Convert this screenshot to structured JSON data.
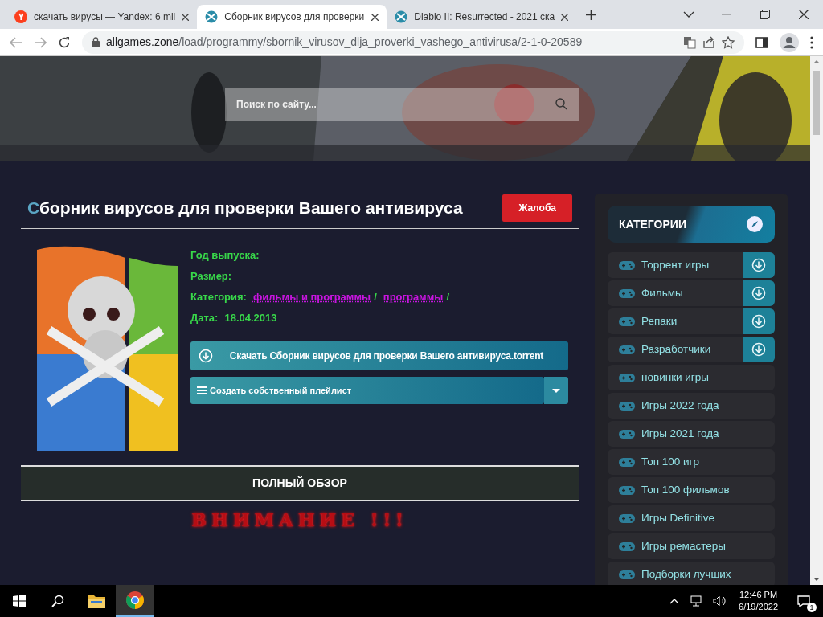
{
  "browser": {
    "tabs": [
      {
        "title": "скачать вирусы — Yandex: 6 mil",
        "kind": "search",
        "selected": false
      },
      {
        "title": "Сборник вирусов для проверки",
        "kind": "site",
        "selected": true
      },
      {
        "title": "Diablo II: Resurrected - 2021 ска",
        "kind": "site",
        "selected": false
      }
    ],
    "url_host": "allgames.zone",
    "url_path": "/load/programmy/sbornik_virusov_dlja_proverki_vashego_antivirusa/2-1-0-20589"
  },
  "search": {
    "placeholder": "Поиск по сайту..."
  },
  "article": {
    "title": "Сборник вирусов для проверки Вашего антивируса",
    "complaint": "Жалоба",
    "fields": [
      {
        "label": "Год выпуска:"
      },
      {
        "label": "Размер:"
      },
      {
        "label": "Категория:",
        "links": [
          {
            "text": "фильмы и программы",
            "separator": "/"
          },
          {
            "text": "программы",
            "separator": "/"
          }
        ]
      },
      {
        "label": "Дата:",
        "value": "18.04.2013"
      }
    ],
    "download": "Скачать Сборник вирусов для проверки Вашего антивируса.torrent",
    "playlist": "Создать собственный плейлист",
    "review_heading": "ПОЛНЫЙ ОБЗОР",
    "warning": "ВНИМАНИЕ !!!"
  },
  "sidebar": {
    "title": "КАТЕГОРИИ",
    "items": [
      {
        "label": "Торрент игры",
        "expandable": true
      },
      {
        "label": "Фильмы",
        "expandable": true
      },
      {
        "label": "Репаки",
        "expandable": true
      },
      {
        "label": "Разработчики",
        "expandable": true
      },
      {
        "label": "новинки игры",
        "expandable": false
      },
      {
        "label": "Игры 2022 года",
        "expandable": false
      },
      {
        "label": "Игры 2021 года",
        "expandable": false
      },
      {
        "label": "Топ 100 игр",
        "expandable": false
      },
      {
        "label": "Топ 100 фильмов",
        "expandable": false
      },
      {
        "label": "Игры Definitive",
        "expandable": false
      },
      {
        "label": "Игры ремастеры",
        "expandable": false
      },
      {
        "label": "Подборки лучших",
        "expandable": false
      }
    ]
  },
  "taskbar": {
    "time": "12:46 PM",
    "date": "6/19/2022",
    "notifications": "1"
  }
}
